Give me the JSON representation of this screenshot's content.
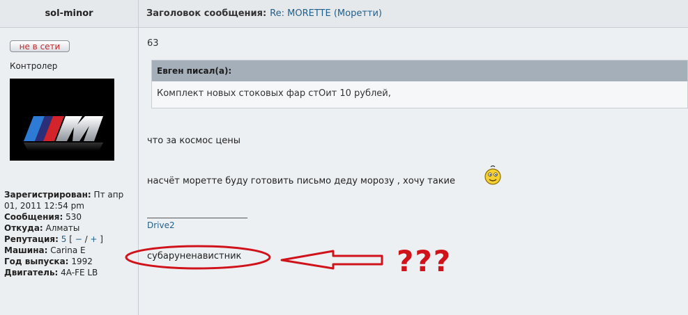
{
  "header": {
    "username": "sol-minor",
    "subject_label": "Заголовок сообщения:",
    "subject": "Re: MORETTE (Моретти)"
  },
  "user": {
    "status_label": "не в сети",
    "rank": "Контролер",
    "registered_label": "Зарегистрирован:",
    "registered_value": "Пт апр 01, 2011 12:54 pm",
    "posts_label": "Сообщения:",
    "posts_value": "530",
    "from_label": "Откуда:",
    "from_value": "Алматы",
    "reputation_label": "Репутация:",
    "reputation_value": "5",
    "reputation_minus": "−",
    "reputation_plus": "+",
    "car_label": "Машина:",
    "car_value": "Carina E",
    "year_label": "Год выпуска:",
    "year_value": "1992",
    "engine_label": "Двигатель:",
    "engine_value": "4A-FE LB"
  },
  "post": {
    "number": "63",
    "quote_author": "Евген писал(а):",
    "quote_text": "Комплект новых стоковых фар стОит 10 рублей,",
    "line1": "что за космос цены",
    "line2": "насчёт моретте буду готовить письмо деду морозу , хочу такие",
    "signature_link": "Drive2",
    "signature_text": "субаруненавистник"
  },
  "annotation": {
    "marks": "???",
    "color": "#d0121b"
  },
  "icons": {
    "avatar": "bmw-m-logo",
    "smiley": "smiley-icon"
  }
}
